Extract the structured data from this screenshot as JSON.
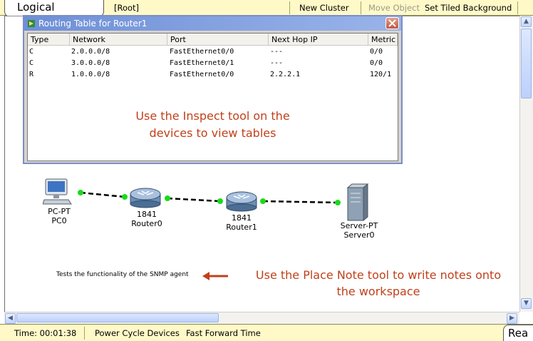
{
  "topbar": {
    "tab_label": "Logical",
    "root_label": "[Root]",
    "new_cluster": "New Cluster",
    "move_object": "Move Object",
    "set_tiled_background": "Set Tiled Background"
  },
  "routing_window": {
    "title": "Routing Table for Router1",
    "columns": [
      "Type",
      "Network",
      "Port",
      "Next Hop IP",
      "Metric"
    ],
    "rows": [
      [
        "C",
        "2.0.0.0/8",
        "FastEthernet0/0",
        "---",
        "0/0"
      ],
      [
        "C",
        "3.0.0.0/8",
        "FastEthernet0/1",
        "---",
        "0/0"
      ],
      [
        "R",
        "1.0.0.0/8",
        "FastEthernet0/0",
        "2.2.2.1",
        "120/1"
      ]
    ],
    "note_line1": "Use the Inspect tool on the",
    "note_line2": "devices to view tables"
  },
  "devices": {
    "pc": {
      "model": "PC-PT",
      "name": "PC0"
    },
    "router0": {
      "model": "1841",
      "name": "Router0"
    },
    "router1": {
      "model": "1841",
      "name": "Router1"
    },
    "server": {
      "model": "Server-PT",
      "name": "Server0"
    }
  },
  "notes": {
    "snmp": "Tests the functionality of the SNMP agent",
    "place_note_line1": "Use the Place Note tool to write notes onto",
    "place_note_line2": "the workspace"
  },
  "bottombar": {
    "time": "Time: 00:01:38",
    "power_cycle": "Power Cycle Devices",
    "fast_forward": "Fast Forward Time",
    "realtime_tab": "Rea"
  },
  "colors": {
    "bar_bg": "#fff9c8",
    "note_text": "#c1401a",
    "link_port": "#18dc18",
    "title_bar": "#6e8fd6"
  }
}
